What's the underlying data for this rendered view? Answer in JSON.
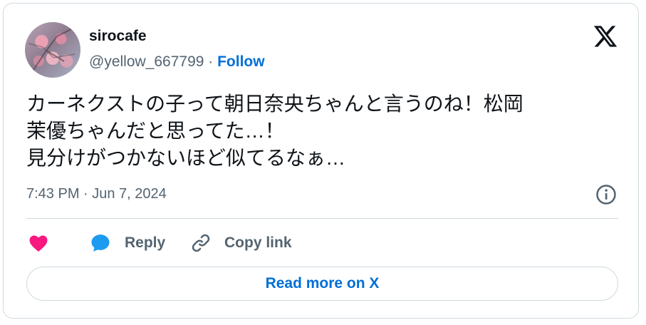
{
  "user": {
    "display_name": "sirocafe",
    "handle": "@yellow_667799",
    "separator": " · ",
    "follow_label": "Follow"
  },
  "tweet": {
    "text": "カーネクストの子って朝日奈央ちゃんと言うのね！松岡\n茉優ちゃんだと思ってた…！\n見分けがつかないほど似てるなぁ…",
    "timestamp": "7:43 PM · Jun 7, 2024"
  },
  "actions": {
    "like_icon": "heart-icon",
    "reply_label": "Reply",
    "copy_label": "Copy link"
  },
  "footer": {
    "read_more_label": "Read more on X"
  },
  "colors": {
    "link": "#006fd6",
    "secondary_text": "#536471",
    "like": "#f91880",
    "reply": "#1d9bf0",
    "border": "#cfd9de"
  },
  "icons": [
    "x-logo-icon",
    "info-icon",
    "heart-icon",
    "reply-bubble-icon",
    "link-icon"
  ]
}
